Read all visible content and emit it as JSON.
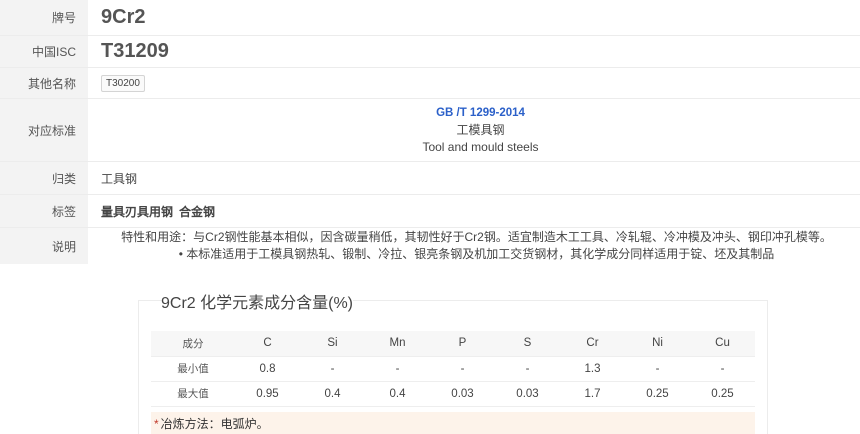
{
  "info": {
    "brand_label": "牌号",
    "brand_value": "9Cr2",
    "isc_label": "中国ISC",
    "isc_value": "T31209",
    "other_label": "其他名称",
    "other_value": "T30200",
    "standard_label": "对应标准",
    "standard_code": "GB /T 1299-2014",
    "standard_name_cn": "工模具钢",
    "standard_name_en": "Tool and mould steels",
    "category_label": "归类",
    "category_value": "工具钢",
    "tags_label": "标签",
    "tags": [
      "量具刃具用钢",
      "合金钢"
    ],
    "desc_label": "说明",
    "desc_line1": "特性和用途：与Cr2钢性能基本相似，因含碳量稍低，其韧性好于Cr2钢。适宜制造木工工具、冷轧辊、冷冲模及冲头、钢印冲孔模等。",
    "desc_line2": "• 本标准适用于工模具钢热轧、锻制、冷拉、银亮条钢及机加工交货钢材，其化学成分同样适用于锭、坯及其制品"
  },
  "composition": {
    "title": "9Cr2 化学元素成分含量(%)",
    "header_label": "成分",
    "elements": [
      "C",
      "Si",
      "Mn",
      "P",
      "S",
      "Cr",
      "Ni",
      "Cu"
    ],
    "min_label": "最小值",
    "min_values": [
      "0.8",
      "-",
      "-",
      "-",
      "-",
      "1.3",
      "-",
      "-"
    ],
    "max_label": "最大值",
    "max_values": [
      "0.95",
      "0.4",
      "0.4",
      "0.03",
      "0.03",
      "1.7",
      "0.25",
      "0.25"
    ],
    "note_star": "*",
    "note": "冶炼方法：电弧炉。"
  }
}
